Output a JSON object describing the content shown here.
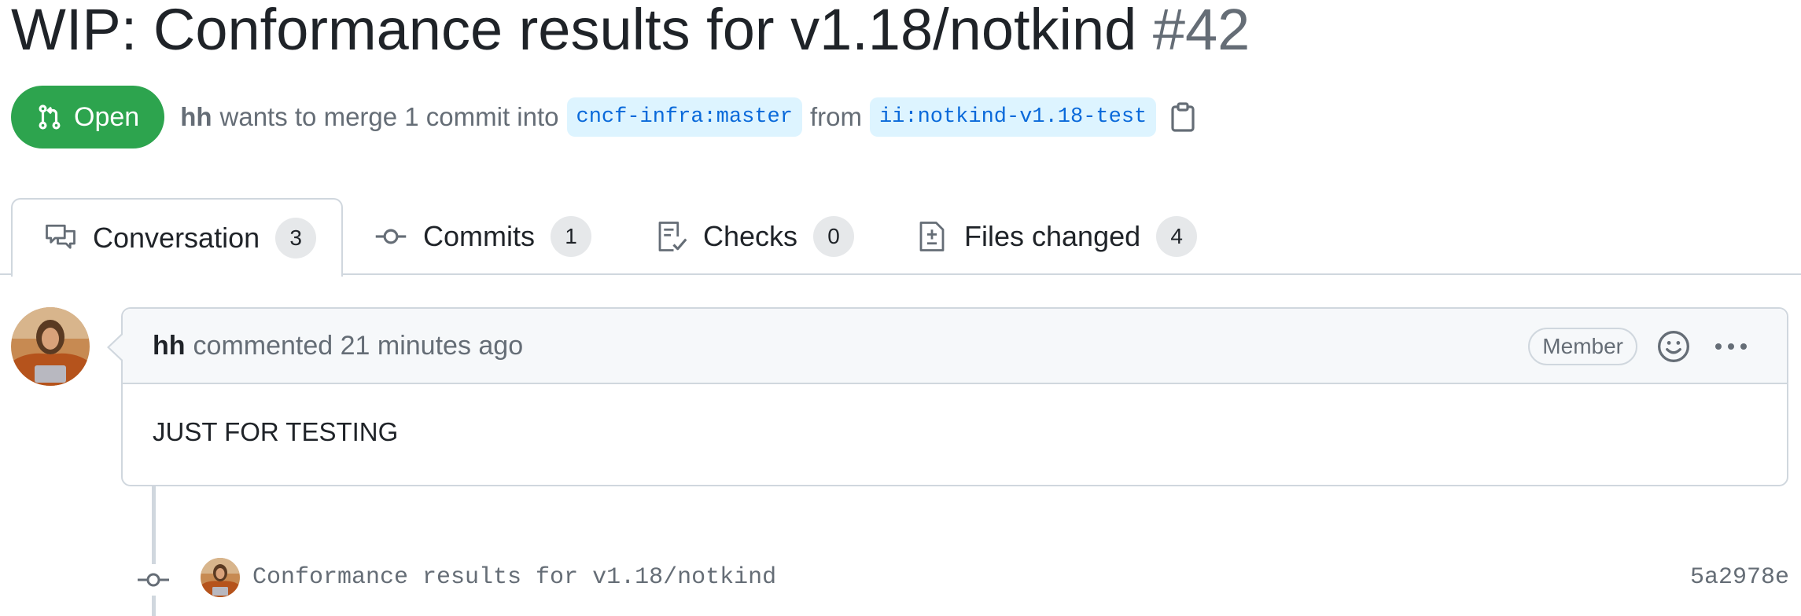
{
  "pr": {
    "title": "WIP: Conformance results for v1.18/notkind",
    "number": "#42",
    "state": "Open",
    "author": "hh",
    "merge_text": "wants to merge 1 commit into",
    "base_branch": "cncf-infra:master",
    "from_text": "from",
    "head_branch": "ii:notkind-v1.18-test"
  },
  "tabs": [
    {
      "label": "Conversation",
      "count": "3",
      "icon": "comment-discussion-icon",
      "active": true
    },
    {
      "label": "Commits",
      "count": "1",
      "icon": "git-commit-icon",
      "active": false
    },
    {
      "label": "Checks",
      "count": "0",
      "icon": "checklist-icon",
      "active": false
    },
    {
      "label": "Files changed",
      "count": "4",
      "icon": "file-diff-icon",
      "active": false
    }
  ],
  "comment": {
    "author": "hh",
    "action": "commented 21 minutes ago",
    "role": "Member",
    "body": "JUST FOR TESTING"
  },
  "commit": {
    "message": "Conformance results for v1.18/notkind",
    "sha": "5a2978e"
  },
  "colors": {
    "open_green": "#2da44e",
    "branch_bg": "#ddf4ff",
    "branch_text": "#0969da",
    "muted_text": "#656d76"
  }
}
